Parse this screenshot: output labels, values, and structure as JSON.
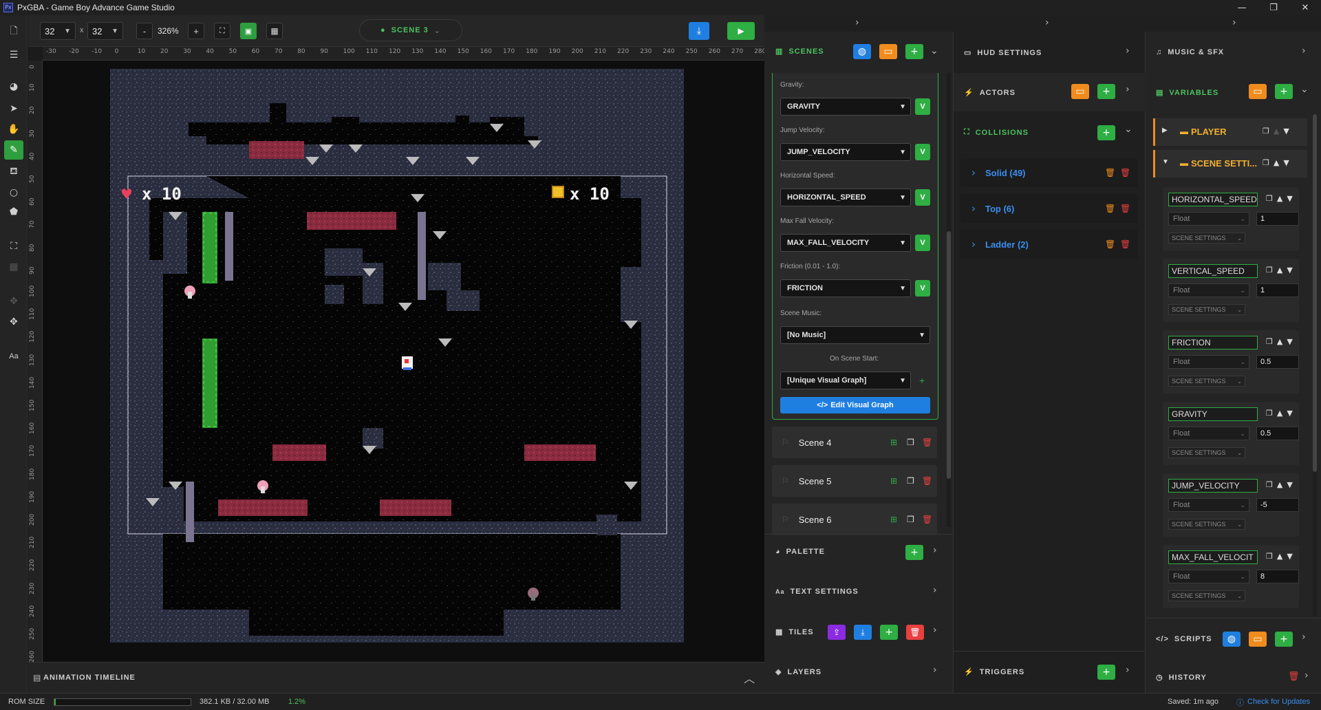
{
  "window": {
    "title": "PxGBA - Game Boy Advance Game Studio",
    "app_icon": "Px"
  },
  "toolbar": {
    "width": "32",
    "x_sep": "x",
    "height": "32",
    "zoom": "326%",
    "minus": "-",
    "plus": "+",
    "scene_selector": "SCENE 3"
  },
  "ruler_top": [
    "-30",
    "-20",
    "-10",
    "0",
    "10",
    "20",
    "30",
    "40",
    "50",
    "60",
    "70",
    "80",
    "90",
    "100",
    "110",
    "120",
    "130",
    "140",
    "150",
    "160",
    "170",
    "180",
    "190",
    "200",
    "210",
    "220",
    "230",
    "240",
    "250",
    "260",
    "270",
    "280"
  ],
  "ruler_left": [
    "0",
    "10",
    "20",
    "30",
    "40",
    "50",
    "60",
    "70",
    "80",
    "90",
    "100",
    "110",
    "120",
    "130",
    "140",
    "150",
    "160",
    "170",
    "180",
    "190",
    "200",
    "210",
    "220",
    "230",
    "240",
    "250",
    "260"
  ],
  "hud": {
    "hearts": "x 10",
    "coins": "x 10"
  },
  "timeline": {
    "label": "ANIMATION TIMELINE"
  },
  "status": {
    "rom_label": "ROM SIZE",
    "rom_value": "382.1 KB / 32.00 MB",
    "rom_percent": "1.2%",
    "rom_fill": 0.012,
    "saved": "Saved: 1m ago",
    "updates": "Check for Updates"
  },
  "scenes_panel": {
    "title": "SCENES",
    "fields": [
      {
        "label": "Gravity:",
        "value": "GRAVITY"
      },
      {
        "label": "Jump Velocity:",
        "value": "JUMP_VELOCITY"
      },
      {
        "label": "Horizontal Speed:",
        "value": "HORIZONTAL_SPEED"
      },
      {
        "label": "Max Fall Velocity:",
        "value": "MAX_FALL_VELOCITY"
      },
      {
        "label": "Friction (0.01 - 1.0):",
        "value": "FRICTION"
      }
    ],
    "v_label": "V",
    "music_label": "Scene Music:",
    "music_value": "[No Music]",
    "on_start_label": "On Scene Start:",
    "on_start_value": "[Unique Visual Graph]",
    "edit_graph": "Edit Visual Graph",
    "scenes": [
      "Scene 4",
      "Scene 5",
      "Scene 6"
    ]
  },
  "bottom_panels": {
    "palette": "PALETTE",
    "text_settings": "TEXT SETTINGS",
    "tiles": "TILES",
    "layers": "LAYERS"
  },
  "mid_panels": {
    "hud_settings": "HUD SETTINGS",
    "actors": "ACTORS",
    "collisions": "COLLISIONS",
    "collision_items": [
      "Solid (49)",
      "Top (6)",
      "Ladder (2)"
    ],
    "triggers": "TRIGGERS"
  },
  "right_panels": {
    "music": "MUSIC & SFX",
    "variables": "VARIABLES",
    "groups": [
      "PLAYER",
      "SCENE SETTI..."
    ],
    "vars": [
      {
        "name": "HORIZONTAL_SPEED",
        "type": "Float",
        "value": "1",
        "category": "SCENE SETTINGS"
      },
      {
        "name": "VERTICAL_SPEED",
        "type": "Float",
        "value": "1",
        "category": "SCENE SETTINGS"
      },
      {
        "name": "FRICTION",
        "type": "Float",
        "value": "0.5",
        "category": "SCENE SETTINGS"
      },
      {
        "name": "GRAVITY",
        "type": "Float",
        "value": "0.5",
        "category": "SCENE SETTINGS"
      },
      {
        "name": "JUMP_VELOCITY",
        "type": "Float",
        "value": "-5",
        "category": "SCENE SETTINGS"
      },
      {
        "name": "MAX_FALL_VELOCIT",
        "type": "Float",
        "value": "8",
        "category": "SCENE SETTINGS"
      }
    ],
    "scripts": "SCRIPTS",
    "history": "HISTORY"
  },
  "colors": {
    "accent_green": "#2eae43",
    "orange": "#f08c1e",
    "blue": "#1f7fe0",
    "link_blue": "#3a8ef0",
    "red": "#e84040"
  }
}
